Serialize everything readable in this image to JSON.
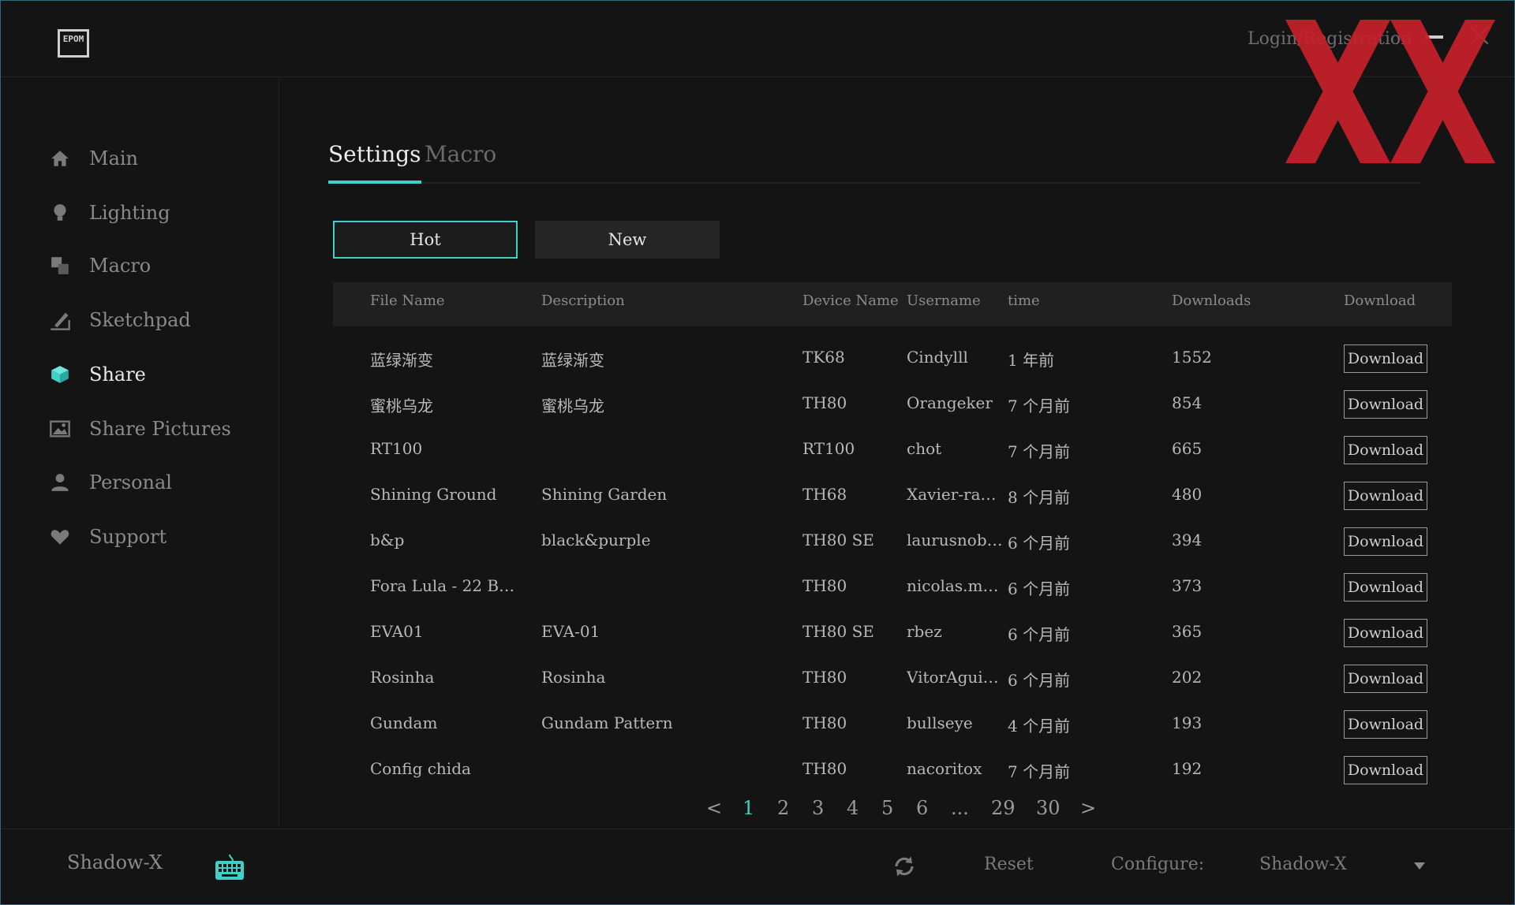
{
  "app": {
    "logo_text": "EPOM",
    "login_label": "Login/Registration"
  },
  "watermark": {
    "color": "#c6202a"
  },
  "sidebar": {
    "items": [
      {
        "label": "Main",
        "icon": "home-icon"
      },
      {
        "label": "Lighting",
        "icon": "bulb-icon"
      },
      {
        "label": "Macro",
        "icon": "macro-icon"
      },
      {
        "label": "Sketchpad",
        "icon": "sketchpad-icon"
      },
      {
        "label": "Share",
        "icon": "cube-icon",
        "active": true
      },
      {
        "label": "Share Pictures",
        "icon": "picture-icon"
      },
      {
        "label": "Personal",
        "icon": "user-icon"
      },
      {
        "label": "Support",
        "icon": "heart-icon"
      }
    ]
  },
  "tabs": [
    {
      "label": "Settings",
      "active": true
    },
    {
      "label": "Macro",
      "active": false
    }
  ],
  "filters": {
    "hot_label": "Hot",
    "new_label": "New",
    "active": "Hot"
  },
  "table": {
    "headers": [
      "File Name",
      "Description",
      "Device Name",
      "Username",
      "time",
      "Downloads",
      "Download"
    ],
    "rows": [
      {
        "file": "蓝绿渐变",
        "desc": "蓝绿渐变",
        "device": "TK68",
        "user": "Cindylll",
        "time": "1 年前",
        "downloads": "1552",
        "action": "Download"
      },
      {
        "file": "蜜桃乌龙",
        "desc": "蜜桃乌龙",
        "device": "TH80",
        "user": "Orangeker",
        "time": "7 个月前",
        "downloads": "854",
        "action": "Download"
      },
      {
        "file": "RT100",
        "desc": "",
        "device": "RT100",
        "user": "chot",
        "time": "7 个月前",
        "downloads": "665",
        "action": "Download"
      },
      {
        "file": "Shining Ground",
        "desc": "Shining Garden",
        "device": "TH68",
        "user": "Xavier-raphi",
        "time": "8 个月前",
        "downloads": "480",
        "action": "Download"
      },
      {
        "file": "b&p",
        "desc": "black&purple",
        "device": "TH80 SE",
        "user": "laurusnobilis",
        "time": "6 个月前",
        "downloads": "394",
        "action": "Download"
      },
      {
        "file": "Fora Lula - 22 B…",
        "desc": "",
        "device": "TH80",
        "user": "nicolas.mo…",
        "time": "6 个月前",
        "downloads": "373",
        "action": "Download"
      },
      {
        "file": "EVA01",
        "desc": "EVA-01",
        "device": "TH80 SE",
        "user": "rbez",
        "time": "6 个月前",
        "downloads": "365",
        "action": "Download"
      },
      {
        "file": "Rosinha",
        "desc": "Rosinha",
        "device": "TH80",
        "user": "VitorAgui…",
        "time": "6 个月前",
        "downloads": "202",
        "action": "Download"
      },
      {
        "file": "Gundam",
        "desc": "Gundam Pattern",
        "device": "TH80",
        "user": "bullseye",
        "time": "4 个月前",
        "downloads": "193",
        "action": "Download"
      },
      {
        "file": "Config chida",
        "desc": "",
        "device": "TH80",
        "user": "nacoritox",
        "time": "7 个月前",
        "downloads": "192",
        "action": "Download"
      }
    ]
  },
  "pagination": {
    "prev": "<",
    "pages": [
      "1",
      "2",
      "3",
      "4",
      "5",
      "6",
      "...",
      "29",
      "30"
    ],
    "current": "1",
    "next": ">"
  },
  "footer": {
    "device_name": "Shadow-X",
    "reset_label": "Reset",
    "configure_label": "Configure:",
    "configure_value": "Shadow-X"
  },
  "colors": {
    "accent": "#3fd1c8",
    "background": "#141414"
  }
}
